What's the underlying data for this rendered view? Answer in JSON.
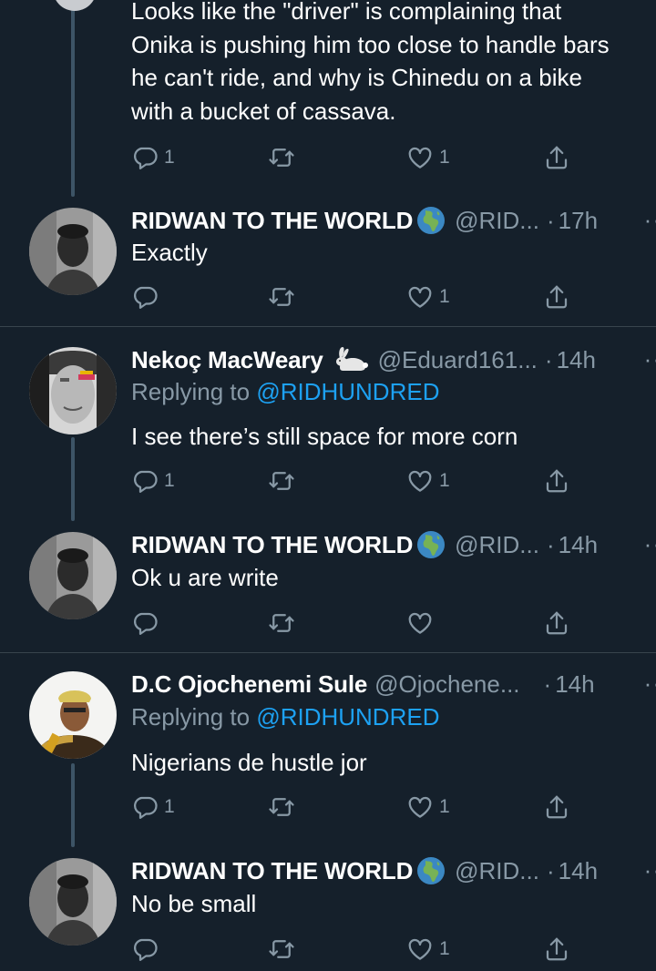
{
  "first_tweet": {
    "text_lines": [
      "Looks like the \"driver\" is complaining that",
      "Onika is pushing him too close to handle bars",
      "he can't ride, and why is Chinedu on a bike",
      "with a bucket of cassava."
    ],
    "reply_count": "1",
    "retweet_count": "",
    "like_count": "1"
  },
  "tweets": [
    {
      "name": "RIDWAN TO THE WORLD",
      "handle": "@RID...",
      "separator": "·",
      "time": "17h",
      "more": "··",
      "replying_prefix": "",
      "replying_mention": "",
      "text": "Exactly",
      "reply_count": "",
      "retweet_count": "",
      "like_count": "1"
    },
    {
      "name": "Nekoç MacWeary",
      "handle": "@Eduard161...",
      "separator": "·",
      "time": "14h",
      "more": "··",
      "replying_prefix": "Replying to ",
      "replying_mention": "@RIDHUNDRED",
      "text": "I see there’s still space for more corn",
      "reply_count": "1",
      "retweet_count": "",
      "like_count": "1"
    },
    {
      "name": "RIDWAN TO THE WORLD",
      "handle": "@RID...",
      "separator": "·",
      "time": "14h",
      "more": "··",
      "replying_prefix": "",
      "replying_mention": "",
      "text": "Ok u are write",
      "reply_count": "",
      "retweet_count": "",
      "like_count": ""
    },
    {
      "name": "D.C Ojochenemi Sule",
      "handle": "@Ojochene...",
      "separator": "·",
      "time": "14h",
      "more": "··",
      "replying_prefix": "Replying to ",
      "replying_mention": "@RIDHUNDRED",
      "text": "Nigerians de hustle jor",
      "reply_count": "1",
      "retweet_count": "",
      "like_count": "1"
    },
    {
      "name": "RIDWAN TO THE WORLD",
      "handle": "@RID...",
      "separator": "·",
      "time": "14h",
      "more": "··",
      "replying_prefix": "",
      "replying_mention": "",
      "text": "No be small",
      "reply_count": "",
      "retweet_count": "",
      "like_count": "1"
    }
  ],
  "icons": {
    "reply": "reply-icon",
    "retweet": "retweet-icon",
    "like": "heart-icon",
    "share": "share-icon",
    "globe_emoji": "globe-africa-emoji",
    "rabbit_emoji": "rabbit-emoji"
  },
  "colors": {
    "background": "#15202b",
    "text_primary": "#ffffff",
    "text_secondary": "#8899a6",
    "link": "#1da1f2",
    "divider": "#38444d",
    "thread_line": "#3d5466"
  }
}
